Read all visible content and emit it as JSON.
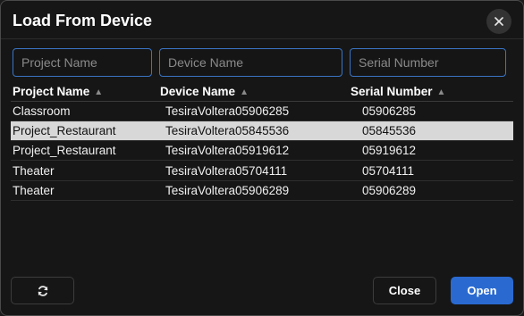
{
  "dialog": {
    "title": "Load From Device"
  },
  "filters": {
    "project_placeholder": "Project Name",
    "device_placeholder": "Device Name",
    "serial_placeholder": "Serial Number"
  },
  "table": {
    "headers": [
      "Project Name",
      "Device Name",
      "Serial Number"
    ],
    "sort_icon": "sort-up-triangle",
    "rows": [
      {
        "project": "Classroom",
        "device": "TesiraVoltera05906285",
        "serial": "05906285",
        "selected": false
      },
      {
        "project": "Project_Restaurant",
        "device": "TesiraVoltera05845536",
        "serial": "05845536",
        "selected": true
      },
      {
        "project": "Project_Restaurant",
        "device": "TesiraVoltera05919612",
        "serial": "05919612",
        "selected": false
      },
      {
        "project": "Theater",
        "device": "TesiraVoltera05704111",
        "serial": "05704111",
        "selected": false
      },
      {
        "project": "Theater",
        "device": "TesiraVoltera05906289",
        "serial": "05906289",
        "selected": false
      }
    ]
  },
  "footer": {
    "refresh_icon": "refresh-icon",
    "close_label": "Close",
    "open_label": "Open"
  },
  "colors": {
    "accent": "#2a6ad0",
    "selected_row": "#d8d8d8",
    "background": "#161616"
  }
}
